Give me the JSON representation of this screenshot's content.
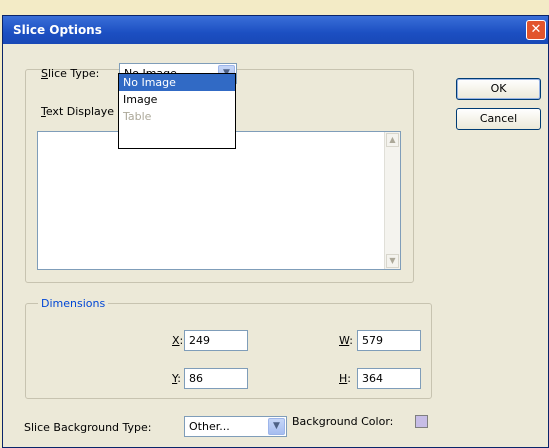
{
  "window": {
    "title": "Slice Options",
    "close_glyph": "✕"
  },
  "slice_type": {
    "label_key": "S",
    "label_rest": "lice Type:",
    "value": "No Image",
    "options": [
      {
        "label": "No Image",
        "state": "selected"
      },
      {
        "label": "Image",
        "state": "normal"
      },
      {
        "label": "Table",
        "state": "disabled"
      }
    ]
  },
  "text_displayed": {
    "label_key": "T",
    "label_rest": "ext Displaye",
    "value": ""
  },
  "buttons": {
    "ok": "OK",
    "cancel": "Cancel"
  },
  "dimensions": {
    "legend": "Dimensions",
    "x": {
      "key": "X",
      "suffix": ":",
      "value": "249"
    },
    "y": {
      "key": "Y",
      "suffix": ":",
      "value": "86"
    },
    "w": {
      "key": "W",
      "suffix": ":",
      "value": "579"
    },
    "h": {
      "key": "H",
      "suffix": ":",
      "value": "364"
    }
  },
  "background": {
    "type_label": "Slice Background Type:",
    "type_value": "Other...",
    "color_label": "Background Color:",
    "color_value": "#c7bde6"
  },
  "icons": {
    "dropdown_arrow": "chevron-down-icon",
    "close": "close-icon",
    "scroll_up": "arrow-up-icon",
    "scroll_down": "arrow-down-icon"
  }
}
